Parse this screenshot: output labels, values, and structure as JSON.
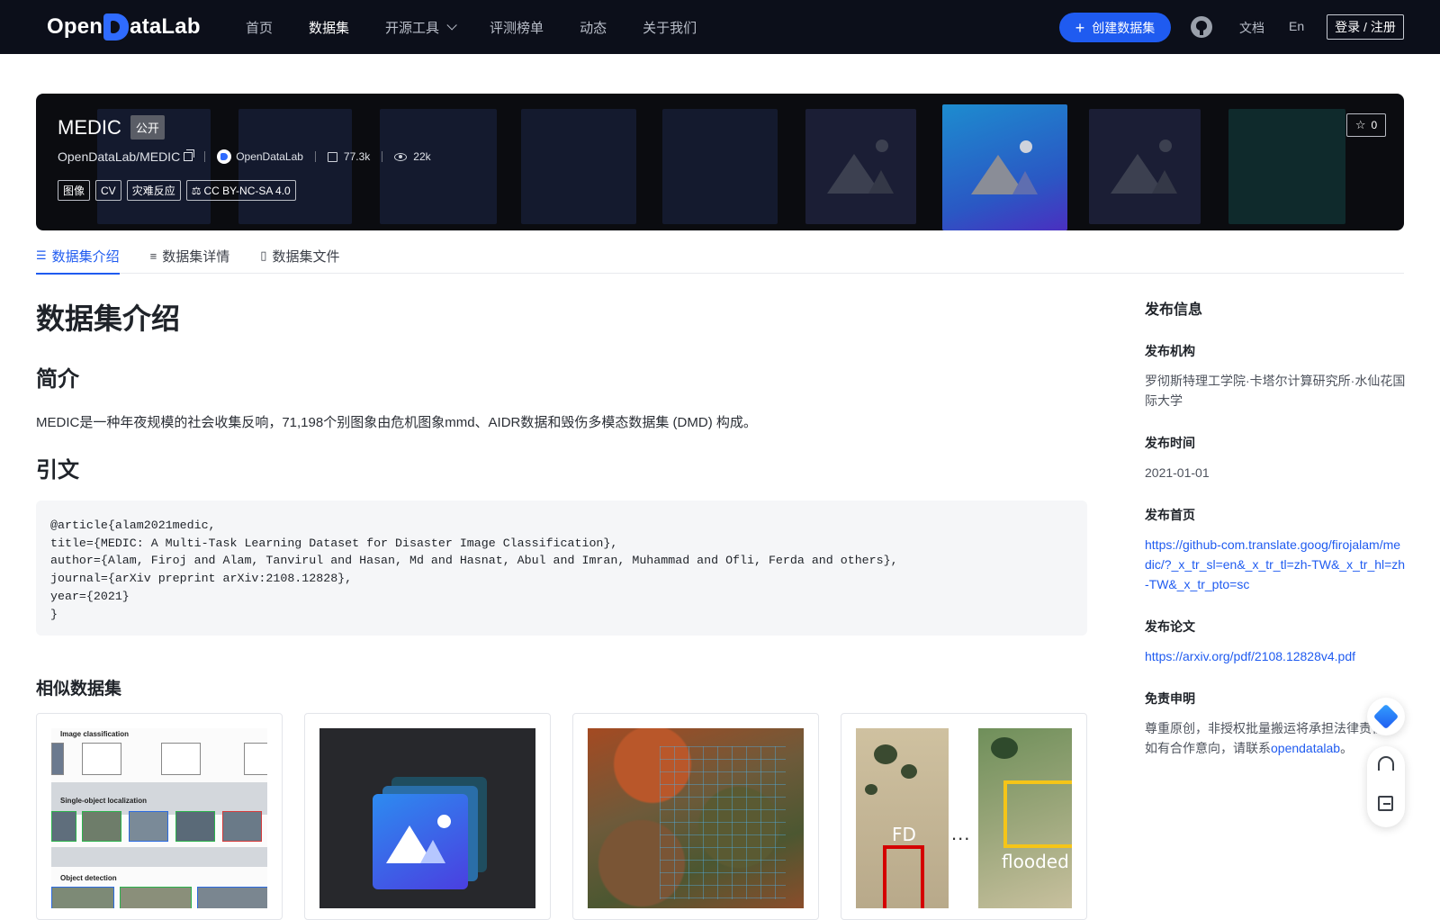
{
  "nav": {
    "logo_text_left": "Open",
    "logo_text_right": "ataLab",
    "links": [
      "首页",
      "数据集",
      "开源工具",
      "评测榜单",
      "动态",
      "关于我们"
    ],
    "active_link": "数据集",
    "create_label": "创建数据集",
    "docs_label": "文档",
    "lang_label": "En",
    "login_label": "登录 / 注册"
  },
  "dataset": {
    "title": "MEDIC",
    "visibility": "公开",
    "path": "OpenDataLab/MEDIC",
    "org": "OpenDataLab",
    "downloads": "77.3k",
    "views": "22k",
    "tags": [
      "图像",
      "CV",
      "灾难反应"
    ],
    "license": "CC BY-NC-SA 4.0",
    "stars": "0"
  },
  "tabs": [
    "数据集介绍",
    "数据集详情",
    "数据集文件"
  ],
  "active_tab": "数据集介绍",
  "content": {
    "heading": "数据集介绍",
    "intro_heading": "简介",
    "intro_text": "MEDIC是一种年夜规模的社会收集反响，71,198个别图象由危机图象mmd、AIDR数据和毁伤多模态数据集 (DMD) 构成。",
    "citation_heading": "引文",
    "citation": "@article{alam2021medic,\ntitle={MEDIC: A Multi-Task Learning Dataset for Disaster Image Classification},\nauthor={Alam, Firoj and Alam, Tanvirul and Hasan, Md and Hasnat, Abul and Imran, Muhammad and Ofli, Ferda and others},\njournal={arXiv preprint arXiv:2108.12828},\nyear={2021}\n}",
    "similar_heading": "相似数据集"
  },
  "card1": {
    "image_classification": "Image classification",
    "single_object_localization": "Single-object localization",
    "object_detection": "Object detection"
  },
  "card4": {
    "label_left": "FD",
    "label_right": "flooded",
    "ellipsis": "..."
  },
  "sidebar": {
    "title": "发布信息",
    "org_label": "发布机构",
    "org_value": "罗彻斯特理工学院·卡塔尔计算研究所·水仙花国际大学",
    "date_label": "发布时间",
    "date_value": "2021-01-01",
    "homepage_label": "发布首页",
    "homepage_value": "https://github-com.translate.goog/firojalam/medic/?_x_tr_sl=en&_x_tr_tl=zh-TW&_x_tr_hl=zh-TW&_x_tr_pto=sc",
    "paper_label": "发布论文",
    "paper_value": "https://arxiv.org/pdf/2108.12828v4.pdf",
    "disclaimer_label": "免责申明",
    "disclaimer_text": "尊重原创，非授权批量搬运将承担法律责任。如有合作意向，请联系",
    "disclaimer_link": "opendatalab",
    "disclaimer_end": "。"
  },
  "icons": {
    "logo": "opendatalab-logo",
    "github": "github-icon",
    "star": "star-icon",
    "license": "scale-icon",
    "float_tools": [
      "diamond-logo-icon",
      "headset-icon",
      "edit-icon"
    ]
  },
  "colors": {
    "nav_bg": "#0c0f1a",
    "accent": "#1f5bf0",
    "banner_bg": "#0b0c10"
  }
}
